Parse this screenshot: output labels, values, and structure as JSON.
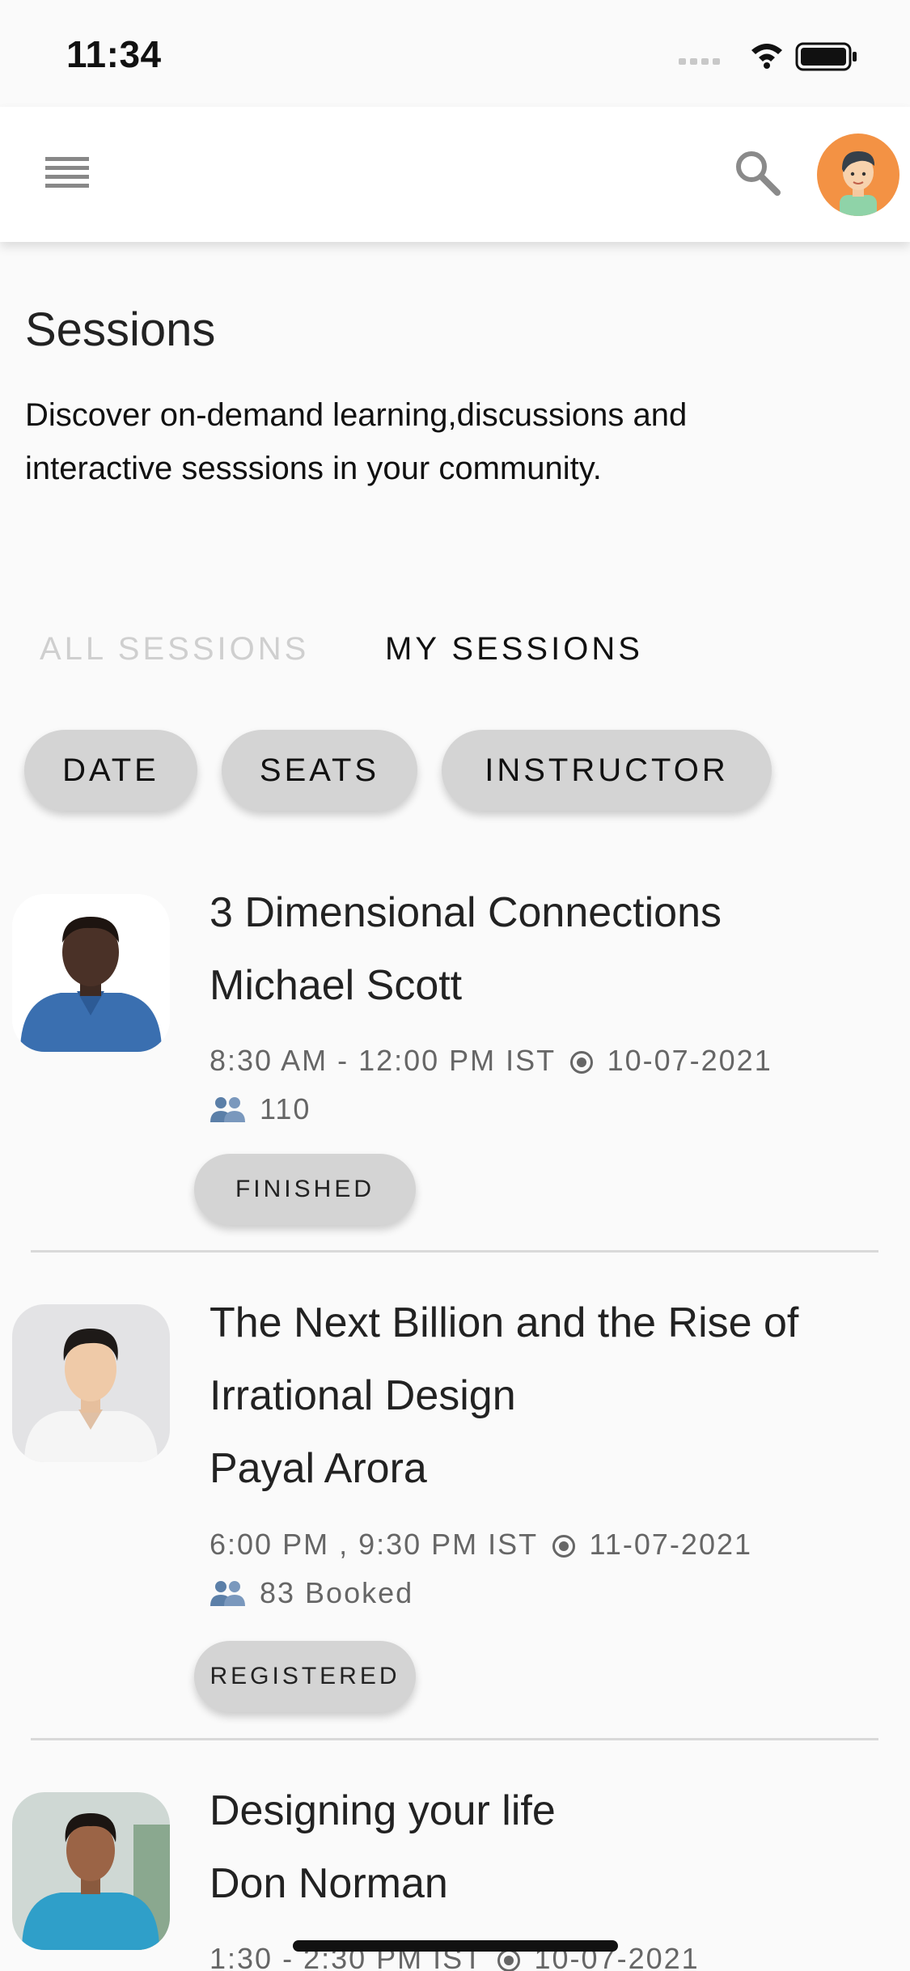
{
  "status_bar": {
    "time": "11:34"
  },
  "page": {
    "title": "Sessions",
    "description": "Discover on-demand learning,discussions and interactive sesssions in your community."
  },
  "tabs": [
    {
      "label": "ALL SESSIONS",
      "active": false
    },
    {
      "label": "MY SESSIONS",
      "active": true
    }
  ],
  "filters": {
    "date": "DATE",
    "seats": "SEATS",
    "instructor": "INSTRUCTOR"
  },
  "sessions": [
    {
      "title": "3 Dimensional Connections",
      "instructor": "Michael Scott",
      "time": "8:30 AM - 12:00 PM IST",
      "date": "10-07-2021",
      "seats": "110",
      "status": "FINISHED"
    },
    {
      "title_line1": "The Next Billion and the Rise of",
      "title_line2": "Irrational Design",
      "instructor": "Payal Arora",
      "time": "6:00 PM , 9:30 PM IST",
      "date": "11-07-2021",
      "seats": "83 Booked",
      "status": "REGISTERED"
    },
    {
      "title": "Designing your life",
      "instructor": "Don Norman",
      "time": "1:30 - 2:30 PM IST",
      "date": "10-07-2021"
    }
  ],
  "colors": {
    "chip_bg": "#d4d4d4",
    "avatar_bg": "#f39244",
    "inactive_tab": "#cfcfcf"
  }
}
